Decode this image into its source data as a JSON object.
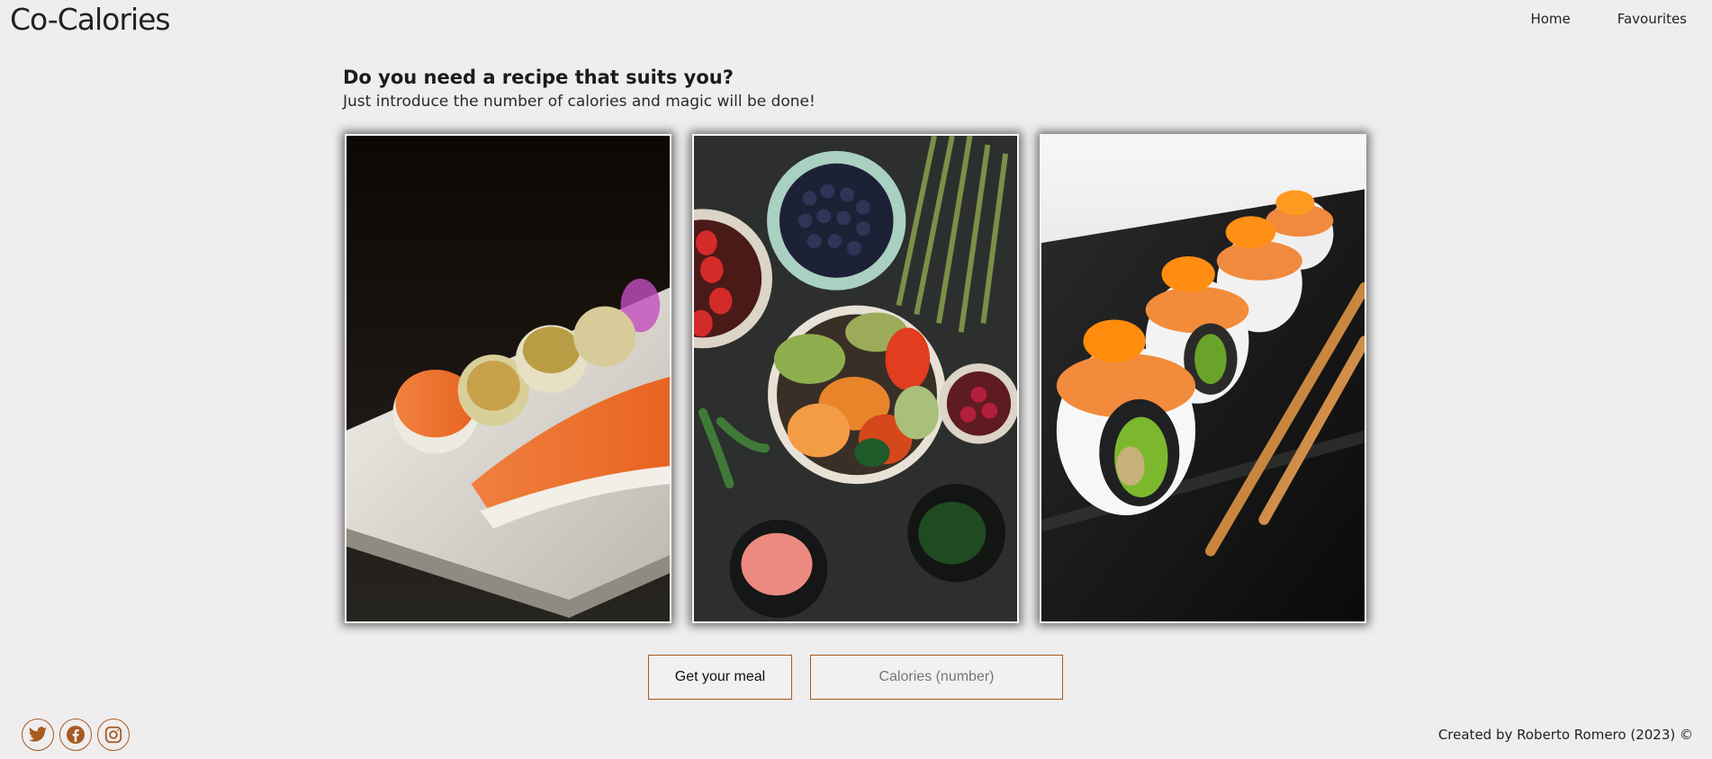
{
  "header": {
    "logo": "Co-Calories",
    "nav": [
      {
        "label": "Home"
      },
      {
        "label": "Favourites"
      }
    ]
  },
  "intro": {
    "title": "Do you need a recipe that suits you?",
    "subtitle": "Just introduce the number of calories and magic will be done!"
  },
  "gallery": {
    "images": [
      {
        "name": "salmon-sushi-plate"
      },
      {
        "name": "healthy-bowl-spread"
      },
      {
        "name": "sushi-rolls-chopsticks"
      }
    ]
  },
  "controls": {
    "button_label": "Get your meal",
    "input_placeholder": "Calories (number)",
    "input_value": ""
  },
  "footer": {
    "social": [
      {
        "icon": "twitter-icon"
      },
      {
        "icon": "facebook-icon"
      },
      {
        "icon": "instagram-icon"
      }
    ],
    "credit": "Created by Roberto Romero (2023) ©"
  },
  "colors": {
    "background": "#efedee",
    "accent": "#a75a22"
  }
}
